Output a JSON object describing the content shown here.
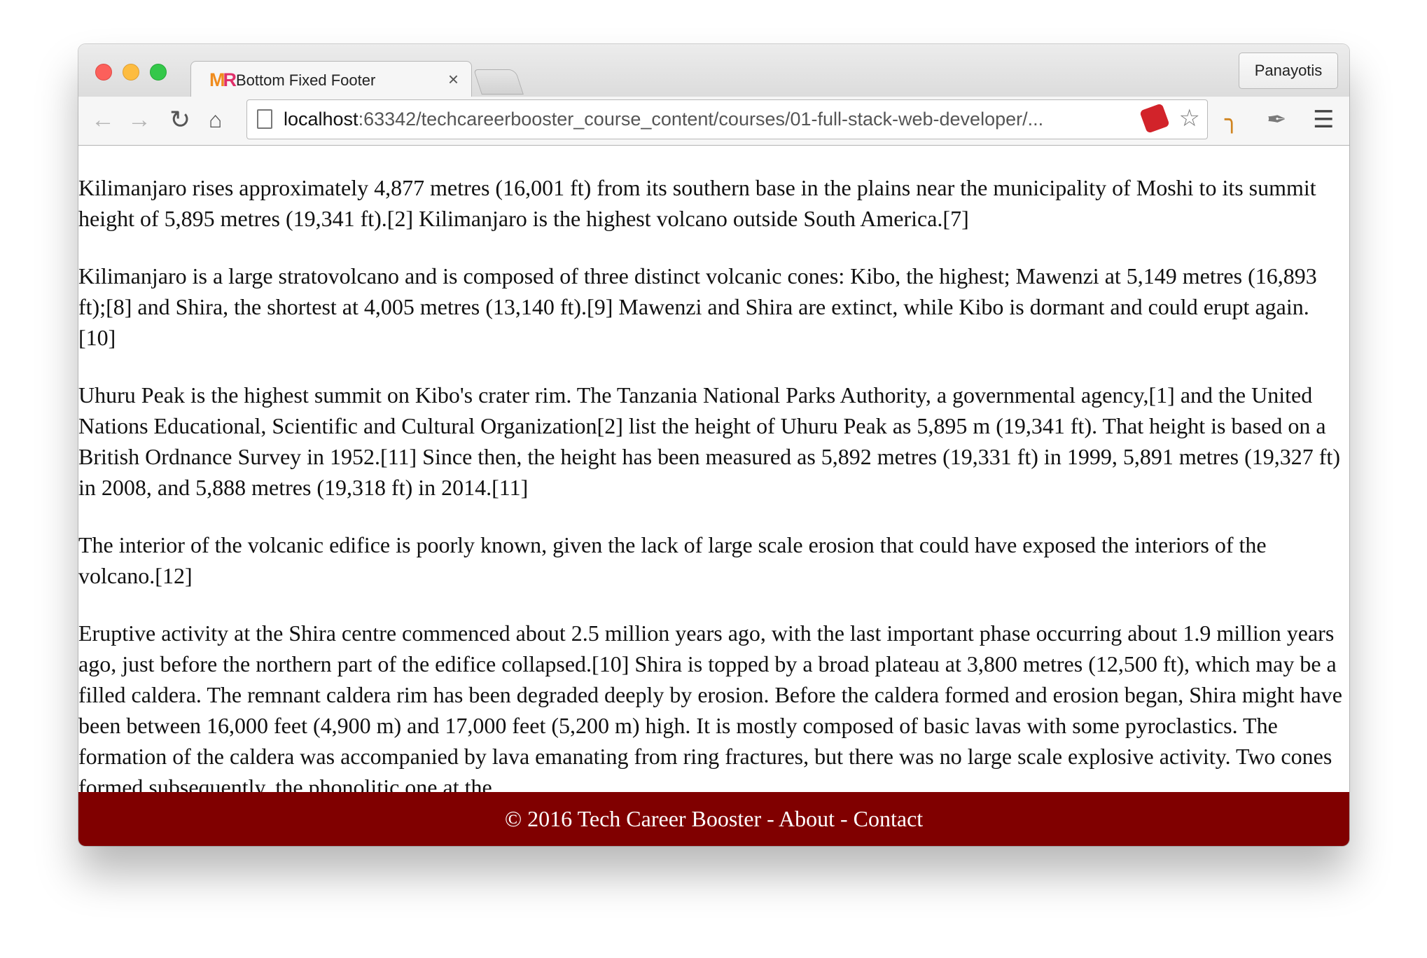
{
  "tab": {
    "title": "Bottom Fixed Footer",
    "close": "×"
  },
  "profile": {
    "name": "Panayotis"
  },
  "addressbar": {
    "host": "localhost",
    "rest": ":63342/techcareerbooster_course_content/courses/01-full-stack-web-developer/..."
  },
  "icons": {
    "back": "arrow-left-icon",
    "forward": "arrow-right-icon",
    "reload": "reload-icon",
    "home": "home-icon",
    "star": "star-icon",
    "menu": "hamburger-menu-icon"
  },
  "article": {
    "paragraphs": [
      "Kilimanjaro rises approximately 4,877 metres (16,001 ft) from its southern base in the plains near the municipality of Moshi to its summit height of 5,895 metres (19,341 ft).[2] Kilimanjaro is the highest volcano outside South America.[7]",
      "Kilimanjaro is a large stratovolcano and is composed of three distinct volcanic cones: Kibo, the highest; Mawenzi at 5,149 metres (16,893 ft);[8] and Shira, the shortest at 4,005 metres (13,140 ft).[9] Mawenzi and Shira are extinct, while Kibo is dormant and could erupt again.[10]",
      "Uhuru Peak is the highest summit on Kibo's crater rim. The Tanzania National Parks Authority, a governmental agency,[1] and the United Nations Educational, Scientific and Cultural Organization[2] list the height of Uhuru Peak as 5,895 m (19,341 ft). That height is based on a British Ordnance Survey in 1952.[11] Since then, the height has been measured as 5,892 metres (19,331 ft) in 1999, 5,891 metres (19,327 ft) in 2008, and 5,888 metres (19,318 ft) in 2014.[11]",
      "The interior of the volcanic edifice is poorly known, given the lack of large scale erosion that could have exposed the interiors of the volcano.[12]",
      "Eruptive activity at the Shira centre commenced about 2.5 million years ago, with the last important phase occurring about 1.9 million years ago, just before the northern part of the edifice collapsed.[10] Shira is topped by a broad plateau at 3,800 metres (12,500 ft), which may be a filled caldera. The remnant caldera rim has been degraded deeply by erosion. Before the caldera formed and erosion began, Shira might have been between 16,000 feet (4,900 m) and 17,000 feet (5,200 m) high. It is mostly composed of basic lavas with some pyroclastics. The formation of the caldera was accompanied by lava emanating from ring fractures, but there was no large scale explosive activity. Two cones formed subsequently, the phonolitic one at the"
    ]
  },
  "footer": {
    "copyright": "© 2016 Tech Career Booster",
    "sep1": " - ",
    "about": "About",
    "sep2": " - ",
    "contact": "Contact"
  }
}
